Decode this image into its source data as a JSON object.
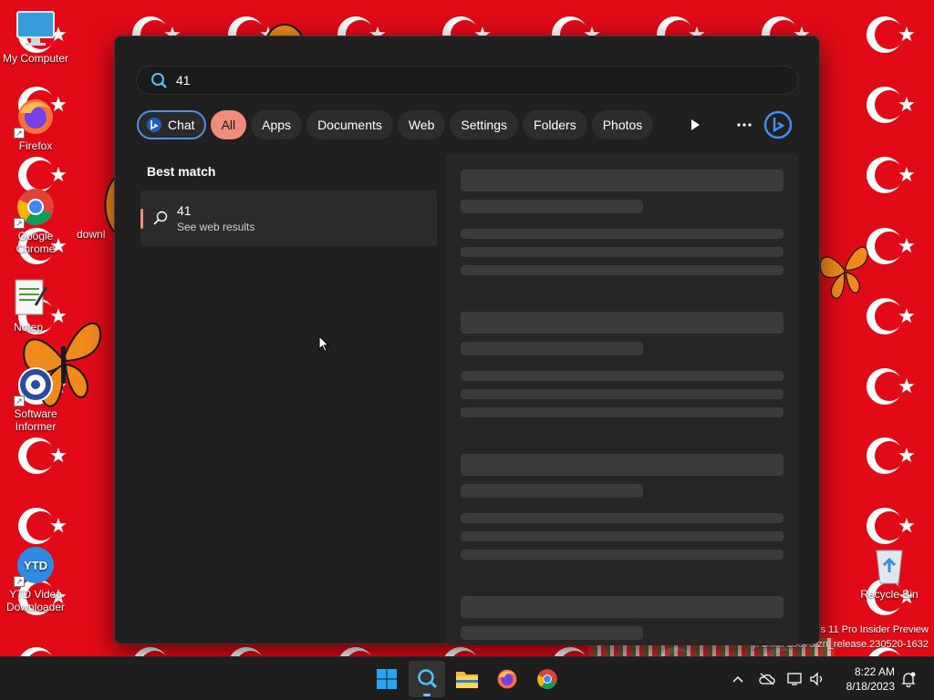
{
  "desktop": {
    "icons": [
      {
        "label": "My Computer",
        "icon": "computer-icon"
      },
      {
        "label": "Firefox",
        "icon": "firefox-icon"
      },
      {
        "label": "Google Chrome",
        "icon": "chrome-icon"
      },
      {
        "label": "Notep",
        "icon": "notepad-icon"
      },
      {
        "label": "Software Informer",
        "icon": "software-informer-icon"
      },
      {
        "label": "YTD Video Downloader",
        "icon": "ytd-icon"
      },
      {
        "label": "downl",
        "icon": "download-icon"
      },
      {
        "label": "Recycle Bin",
        "icon": "recycle-bin-icon"
      }
    ],
    "watermark_line1": "s 11 Pro Insider Preview",
    "watermark_line2": "y. Build 25375.zn_release.230520-1632",
    "colors": {
      "wallpaper": "#e30a17",
      "flag_mark": "#ffffff"
    }
  },
  "search": {
    "query": "41",
    "filters": [
      "Chat",
      "All",
      "Apps",
      "Documents",
      "Web",
      "Settings",
      "Folders",
      "Photos"
    ],
    "active_filter": "All",
    "best_match_label": "Best match",
    "result_title": "41",
    "result_subtitle": "See web results",
    "colors": {
      "accent": "#ef8c7c",
      "chat_border": "#4f8fe6",
      "panel": "#202020"
    }
  },
  "taskbar": {
    "apps": [
      "start-icon",
      "search-icon",
      "file-explorer-icon",
      "firefox-icon",
      "chrome-icon"
    ],
    "time": "8:22 AM",
    "date": "8/18/2023"
  }
}
